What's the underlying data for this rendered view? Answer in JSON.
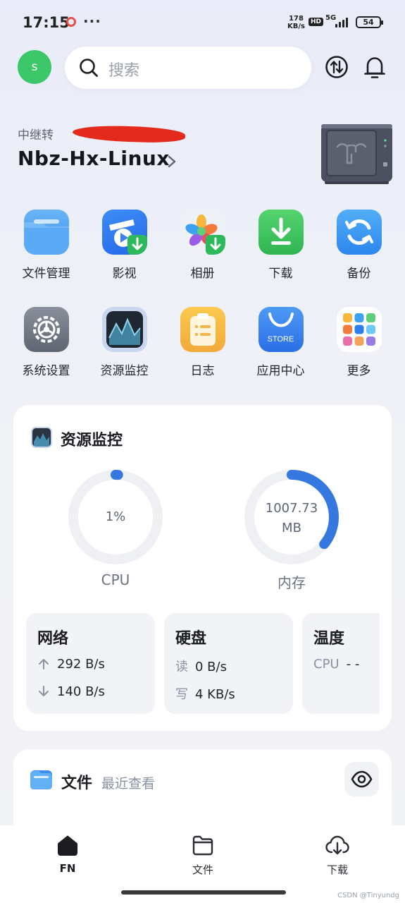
{
  "status_bar": {
    "time": "17:15",
    "dots": "···",
    "speed_value": "178",
    "speed_unit": "KB/s",
    "hd": "HD",
    "network": "5G",
    "battery": "54"
  },
  "header": {
    "avatar_letter": "s",
    "search_placeholder": "搜索",
    "icons": [
      "search-icon",
      "transfer-icon",
      "bell-icon"
    ]
  },
  "device": {
    "subtitle": "中继转",
    "name": "Nbz-Hx-Linux"
  },
  "apps": [
    {
      "label": "文件管理",
      "icon": "folder-icon"
    },
    {
      "label": "影视",
      "icon": "video-icon"
    },
    {
      "label": "相册",
      "icon": "photos-icon"
    },
    {
      "label": "下载",
      "icon": "download-icon"
    },
    {
      "label": "备份",
      "icon": "backup-icon"
    },
    {
      "label": "系统设置",
      "icon": "settings-icon"
    },
    {
      "label": "资源监控",
      "icon": "monitor-icon"
    },
    {
      "label": "日志",
      "icon": "log-icon"
    },
    {
      "label": "应用中心",
      "icon": "store-icon",
      "badge": "STORE"
    },
    {
      "label": "更多",
      "icon": "more-icon"
    }
  ],
  "monitor": {
    "title": "资源监控",
    "cpu": {
      "value": "1%",
      "label": "CPU",
      "fraction": 0.01
    },
    "memory": {
      "value_line1": "1007.73",
      "value_line2": "MB",
      "label": "内存",
      "fraction": 0.36
    },
    "network": {
      "title": "网络",
      "up": "292 B/s",
      "down": "140 B/s"
    },
    "disk": {
      "title": "硬盘",
      "read_key": "读",
      "read": "0 B/s",
      "write_key": "写",
      "write": "4 KB/s"
    },
    "temperature": {
      "title": "温度",
      "cpu_key": "CPU",
      "cpu_value": "- -"
    }
  },
  "files": {
    "title": "文件",
    "subtitle": "最近查看"
  },
  "bottom_nav": [
    {
      "label": "FN",
      "icon": "home-icon",
      "active": true
    },
    {
      "label": "文件",
      "icon": "folder-outline-icon",
      "active": false
    },
    {
      "label": "下载",
      "icon": "cloud-download-icon",
      "active": false
    }
  ],
  "watermark": "CSDN @Tinyundg",
  "colors": {
    "accent_blue": "#3478e0",
    "avatar_green": "#3cc76a",
    "gauge_track": "#eef0f4"
  }
}
